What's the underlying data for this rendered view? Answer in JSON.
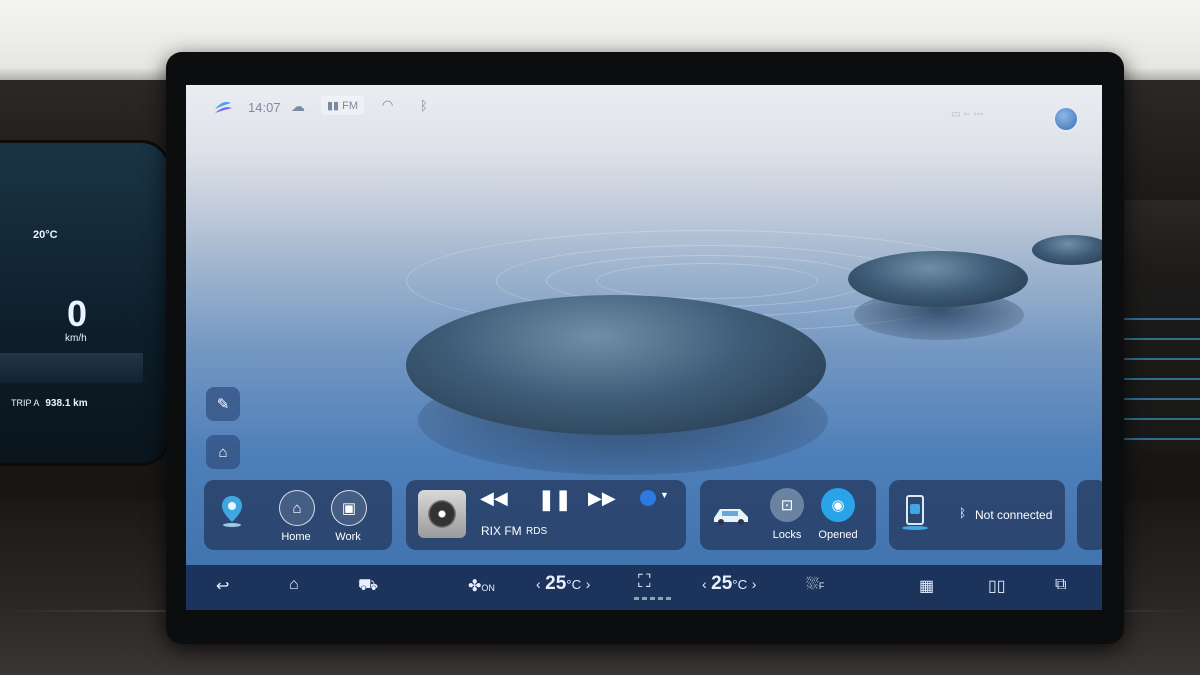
{
  "cluster": {
    "outside_temp": "20°C",
    "speed": "0",
    "speed_unit": "km/h",
    "trip_label": "TRIP A",
    "trip_value": "938.1 km"
  },
  "status_bar": {
    "time": "14:07",
    "radio_band": "FM",
    "icons": [
      "app-logo-icon",
      "cloud-icon",
      "signal-icon",
      "wifi-icon",
      "bluetooth-icon",
      "profile-icon"
    ]
  },
  "side_buttons": [
    "edit-widgets-icon",
    "home-screen-icon"
  ],
  "navigation_card": {
    "shortcuts": [
      {
        "label": "Home",
        "icon": "home-icon"
      },
      {
        "label": "Work",
        "icon": "briefcase-icon"
      }
    ]
  },
  "media_card": {
    "station": "RIX FM",
    "rds": "RDS",
    "controls": [
      "previous-icon",
      "pause-icon",
      "next-icon"
    ]
  },
  "vehicle_card": {
    "buttons": [
      {
        "label": "Locks",
        "icon": "lock-icon"
      },
      {
        "label": "Opened",
        "icon": "camera-icon"
      }
    ]
  },
  "phone_card": {
    "status": "Not connected"
  },
  "dock": {
    "fan_label": "ON",
    "driver_temp": "25",
    "passenger_temp": "25",
    "temp_unit": "°C",
    "defrost_label": "F"
  },
  "colors": {
    "accent": "#3fa8e0",
    "card_bg": "#243a60",
    "dock_bg": "#182c52"
  }
}
